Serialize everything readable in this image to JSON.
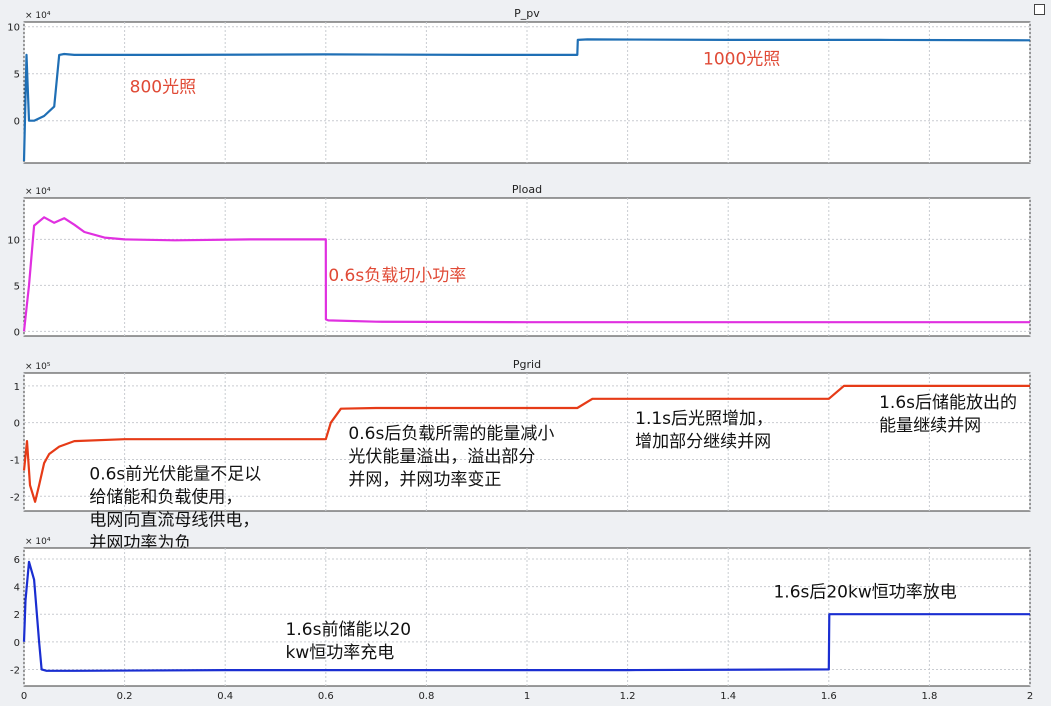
{
  "chart_data": [
    {
      "type": "line",
      "title": "P_pv",
      "y_multiplier": "× 10⁴",
      "ylim": [
        -4.5,
        10.5
      ],
      "yticks": [
        -5,
        0,
        5,
        10
      ],
      "xlim": [
        0,
        2
      ],
      "grid": true,
      "color": "#1f6fb5",
      "series": [
        {
          "x": [
            0,
            0.005,
            0.01,
            0.02,
            0.04,
            0.06,
            0.07,
            0.08,
            0.1,
            0.3,
            0.6,
            0.9,
            1.1,
            1.101,
            1.12,
            1.4,
            1.7,
            2.0
          ],
          "y": [
            -4.3,
            7.0,
            0.0,
            0.0,
            0.5,
            1.5,
            7.0,
            7.1,
            7.0,
            7.0,
            7.05,
            7.0,
            7.0,
            8.6,
            8.65,
            8.6,
            8.6,
            8.55
          ]
        }
      ],
      "annotations": [
        {
          "text": "800光照",
          "x": 0.21,
          "y": 3.0,
          "color": "#e04a36"
        },
        {
          "text": "1000光照",
          "x": 1.35,
          "y": 6.0,
          "color": "#e04a36"
        }
      ]
    },
    {
      "type": "line",
      "title": "Pload",
      "y_multiplier": "× 10⁴",
      "ylim": [
        -0.5,
        14.5
      ],
      "yticks": [
        0,
        5,
        10
      ],
      "xlim": [
        0,
        2
      ],
      "grid": true,
      "color": "#e030e0",
      "series": [
        {
          "x": [
            0,
            0.01,
            0.02,
            0.04,
            0.06,
            0.08,
            0.1,
            0.12,
            0.16,
            0.2,
            0.3,
            0.45,
            0.6,
            0.6001,
            0.605,
            0.7,
            1.0,
            1.3,
            1.6,
            1.8,
            2.0
          ],
          "y": [
            0,
            5.0,
            11.5,
            12.4,
            11.8,
            12.3,
            11.6,
            10.8,
            10.2,
            10.0,
            9.9,
            10.0,
            10.0,
            1.3,
            1.2,
            1.05,
            1.0,
            1.0,
            1.0,
            1.0,
            1.0
          ]
        }
      ],
      "annotations": [
        {
          "text": "0.6s负载切小功率",
          "x": 0.605,
          "y": 5.5,
          "color": "#e04a36"
        }
      ]
    },
    {
      "type": "line",
      "title": "Pgrid",
      "y_multiplier": "× 10⁵",
      "ylim": [
        -2.4,
        1.35
      ],
      "yticks": [
        -2,
        -1,
        0,
        1
      ],
      "xlim": [
        0,
        2
      ],
      "grid": true,
      "color": "#e63b17",
      "series": [
        {
          "x": [
            0,
            0.006,
            0.012,
            0.022,
            0.03,
            0.04,
            0.05,
            0.07,
            0.1,
            0.2,
            0.4,
            0.6,
            0.61,
            0.63,
            0.7,
            0.9,
            1.1,
            1.13,
            1.3,
            1.6,
            1.63,
            1.7,
            2.0
          ],
          "y": [
            -1.3,
            -0.5,
            -1.7,
            -2.15,
            -1.7,
            -1.1,
            -0.85,
            -0.65,
            -0.5,
            -0.45,
            -0.45,
            -0.45,
            0.0,
            0.38,
            0.4,
            0.4,
            0.4,
            0.65,
            0.65,
            0.65,
            1.0,
            1.0,
            1.0
          ]
        }
      ],
      "annotations": [
        {
          "text": "0.6s前光伏能量不足以\n给储能和负载使用，\n电网向直流母线供电，\n并网功率为负",
          "x": 0.13,
          "y": -1.55,
          "color": "#111111"
        },
        {
          "text": "0.6s后负载所需的能量减小\n光伏能量溢出，溢出部分\n并网，并网功率变正",
          "x": 0.645,
          "y": -0.45,
          "color": "#111111"
        },
        {
          "text": "1.1s后光照增加，\n增加部分继续并网",
          "x": 1.215,
          "y": -0.03,
          "color": "#111111"
        },
        {
          "text": "1.6s后储能放出的\n能量继续并网",
          "x": 1.7,
          "y": 0.4,
          "color": "#111111"
        }
      ]
    },
    {
      "type": "line",
      "title": "",
      "y_multiplier": "× 10⁴",
      "ylim": [
        -3.2,
        6.8
      ],
      "yticks": [
        -2,
        0,
        2,
        4,
        6
      ],
      "xlim": [
        0,
        2
      ],
      "xticks": [
        0,
        0.2,
        0.4,
        0.6,
        0.8,
        1,
        1.2,
        1.4,
        1.6,
        1.8,
        2
      ],
      "grid": true,
      "color": "#1a2ed1",
      "series": [
        {
          "x": [
            0,
            0.003,
            0.01,
            0.02,
            0.03,
            0.035,
            0.045,
            0.1,
            0.4,
            0.8,
            1.2,
            1.6,
            1.601,
            1.62,
            1.8,
            2.0
          ],
          "y": [
            0,
            3.0,
            5.8,
            4.5,
            0.0,
            -2.0,
            -2.1,
            -2.1,
            -2.05,
            -2.05,
            -2.05,
            -2.0,
            2.0,
            2.0,
            2.0,
            2.0
          ]
        }
      ],
      "annotations": [
        {
          "text": "1.6s前储能以20\nkw恒功率充电",
          "x": 0.52,
          "y": 0.5,
          "color": "#111111"
        },
        {
          "text": "1.6s后20kw恒功率放电",
          "x": 1.49,
          "y": 3.2,
          "color": "#111111"
        }
      ]
    }
  ]
}
